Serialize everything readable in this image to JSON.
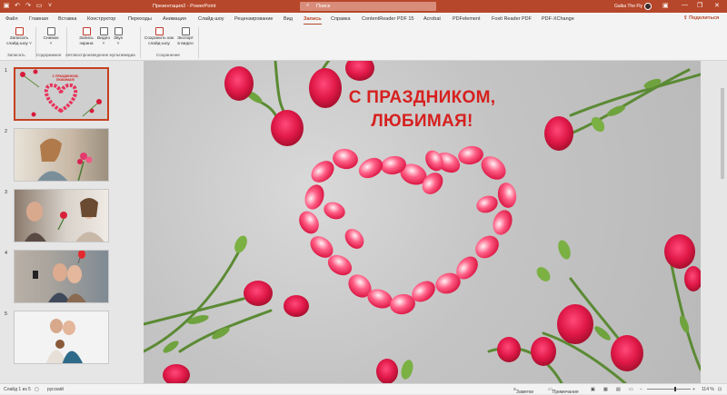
{
  "titlebar": {
    "title": "Презентация2 - PowerPoint",
    "search_placeholder": "Поиск",
    "user": "Galka The Fly",
    "minimize": "—",
    "restore": "❐",
    "close": "✕"
  },
  "tabs": [
    "Файл",
    "Главная",
    "Вставка",
    "Конструктор",
    "Переходы",
    "Анимация",
    "Слайд-шоу",
    "Рецензирование",
    "Вид",
    "Запись",
    "Справка",
    "ContentReader PDF 15",
    "Acrobat",
    "PDFelement",
    "Foxit Reader PDF",
    "PDF-XChange"
  ],
  "active_tab": "Запись",
  "share_label": "Поделиться",
  "ribbon": {
    "record_slideshow": [
      "Записать",
      "слайд-шоу ˅"
    ],
    "screenshot": [
      "Снимок",
      "˅"
    ],
    "screen_recording": [
      "Запись",
      "экрана"
    ],
    "video": [
      "Видео",
      "˅"
    ],
    "audio": [
      "Звук",
      "˅"
    ],
    "save_as_show": [
      "Сохранить как",
      "слайд-шоу"
    ],
    "export_video": [
      "Экспорт",
      "в видео"
    ],
    "groups": {
      "record": "Записать",
      "content": "Содержимое",
      "autoplay": "Автовоспроизведение мультимедиа",
      "save": "Сохранение"
    }
  },
  "slides": {
    "numbers": [
      "1",
      "2",
      "3",
      "4",
      "5"
    ],
    "thumb1_title": "С ПРАЗДНИКОМ, ЛЮБИМАЯ!"
  },
  "slide": {
    "title_line1": "С ПРАЗДНИКОМ,",
    "title_line2": "ЛЮБИМАЯ!"
  },
  "status": {
    "slide_info": "Слайд 1 из 5",
    "language": "русский",
    "notes": "Заметки",
    "comments": "Примечания",
    "zoom": "114 %"
  },
  "colors": {
    "accent": "#b7472a",
    "title_red": "#d6201f"
  }
}
